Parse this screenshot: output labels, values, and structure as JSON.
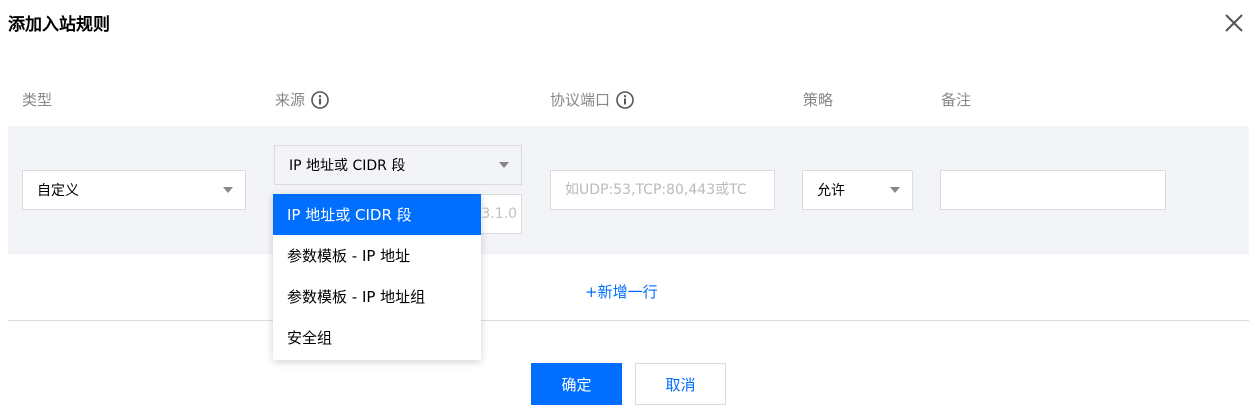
{
  "dialog": {
    "title": "添加入站规则"
  },
  "table": {
    "headers": {
      "type": "类型",
      "source": "来源",
      "port": "协议端口",
      "policy": "策略",
      "note": "备注"
    }
  },
  "row": {
    "type_value": "自定义",
    "source_value": "IP 地址或 CIDR 段",
    "source_input_partial": "3.1.0",
    "port_placeholder": "如UDP:53,TCP:80,443或TC",
    "policy_value": "允许",
    "note_value": ""
  },
  "dropdown": {
    "options": [
      {
        "label": "IP 地址或 CIDR 段",
        "selected": true
      },
      {
        "label": "参数模板 - IP 地址",
        "selected": false
      },
      {
        "label": "参数模板 - IP 地址组",
        "selected": false
      },
      {
        "label": "安全组",
        "selected": false
      }
    ]
  },
  "actions": {
    "add_row": "+新增一行",
    "confirm": "确定",
    "cancel": "取消"
  },
  "colors": {
    "primary": "#006eff",
    "row_bg": "#f3f4f7",
    "header_text": "#888888"
  },
  "icons": {
    "close": "close-icon",
    "info": "info-icon",
    "caret": "caret-down-icon"
  }
}
